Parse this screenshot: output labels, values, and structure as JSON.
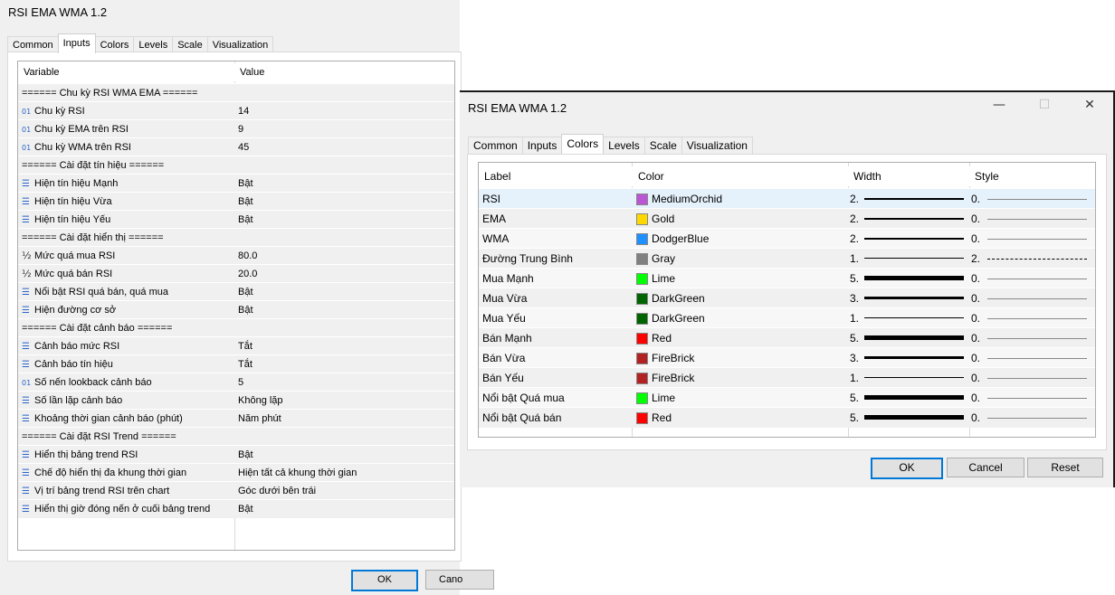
{
  "inputs_dialog": {
    "title": "RSI EMA WMA 1.2",
    "tabs": [
      "Common",
      "Inputs",
      "Colors",
      "Levels",
      "Scale",
      "Visualization"
    ],
    "active_tab": "Inputs",
    "columns": [
      "Variable",
      "Value"
    ],
    "rows": [
      {
        "icon": "",
        "variable": "====== Chu kỳ RSI WMA EMA ======",
        "value": ""
      },
      {
        "icon": "01",
        "variable": "Chu kỳ RSI",
        "value": "14"
      },
      {
        "icon": "01",
        "variable": "Chu kỳ EMA trên RSI",
        "value": "9"
      },
      {
        "icon": "01",
        "variable": "Chu kỳ WMA trên RSI",
        "value": "45"
      },
      {
        "icon": "",
        "variable": "====== Cài đặt tín hiệu ======",
        "value": ""
      },
      {
        "icon": "list",
        "variable": "Hiện tín hiệu Mạnh",
        "value": "Bật"
      },
      {
        "icon": "list",
        "variable": "Hiện tín hiệu Vừa",
        "value": "Bật"
      },
      {
        "icon": "list",
        "variable": "Hiện tín hiệu Yếu",
        "value": "Bật"
      },
      {
        "icon": "",
        "variable": "====== Cài đặt hiển thị ======",
        "value": ""
      },
      {
        "icon": "half",
        "variable": "Mức quá mua RSI",
        "value": "80.0"
      },
      {
        "icon": "half",
        "variable": "Mức quá bán RSI",
        "value": "20.0"
      },
      {
        "icon": "list",
        "variable": "Nổi bật RSI quá bán, quá mua",
        "value": "Bật"
      },
      {
        "icon": "list",
        "variable": "Hiện đường cơ sở",
        "value": "Bật"
      },
      {
        "icon": "",
        "variable": "====== Cài đặt cảnh báo ======",
        "value": ""
      },
      {
        "icon": "list",
        "variable": "Cảnh báo mức RSI",
        "value": "Tắt"
      },
      {
        "icon": "list",
        "variable": "Cảnh báo tín hiệu",
        "value": "Tắt"
      },
      {
        "icon": "01",
        "variable": "Số nến lookback cảnh báo",
        "value": "5"
      },
      {
        "icon": "list",
        "variable": "Số lần lặp cảnh báo",
        "value": "Không lặp"
      },
      {
        "icon": "list",
        "variable": "Khoảng thời gian cảnh báo (phút)",
        "value": "Năm phút"
      },
      {
        "icon": "",
        "variable": "====== Cài đặt RSI Trend ======",
        "value": ""
      },
      {
        "icon": "list",
        "variable": "Hiển thị bảng trend RSI",
        "value": "Bật"
      },
      {
        "icon": "list",
        "variable": "Chế độ hiển thị đa khung thời gian",
        "value": "Hiện tất cả khung thời gian"
      },
      {
        "icon": "list",
        "variable": "Vị trí bảng trend RSI trên chart",
        "value": "Góc dưới bên trái"
      },
      {
        "icon": "list",
        "variable": "Hiển thị giờ đóng nến ở cuối bảng trend",
        "value": "Bật"
      }
    ],
    "ok_label": "OK",
    "cancel_label": "Cano"
  },
  "colors_dialog": {
    "title": "RSI EMA WMA 1.2",
    "minimize_glyph": "—",
    "maximize_glyph": "☐",
    "close_glyph": "✕",
    "tabs": [
      "Common",
      "Inputs",
      "Colors",
      "Levels",
      "Scale",
      "Visualization"
    ],
    "active_tab": "Colors",
    "columns": [
      "Label",
      "Color",
      "Width",
      "Style"
    ],
    "rows": [
      {
        "label": "RSI",
        "color_name": "MediumOrchid",
        "color": "#BA55D3",
        "width": "2.",
        "width_val": 2,
        "style": "0.",
        "dashed": false
      },
      {
        "label": "EMA",
        "color_name": "Gold",
        "color": "#FFD700",
        "width": "2.",
        "width_val": 2,
        "style": "0.",
        "dashed": false
      },
      {
        "label": "WMA",
        "color_name": "DodgerBlue",
        "color": "#1E90FF",
        "width": "2.",
        "width_val": 2,
        "style": "0.",
        "dashed": false
      },
      {
        "label": "Đường Trung Bình",
        "color_name": "Gray",
        "color": "#808080",
        "width": "1.",
        "width_val": 1,
        "style": "2.",
        "dashed": true
      },
      {
        "label": "Mua Mạnh",
        "color_name": "Lime",
        "color": "#00FF00",
        "width": "5.",
        "width_val": 5,
        "style": "0.",
        "dashed": false
      },
      {
        "label": "Mua Vừa",
        "color_name": "DarkGreen",
        "color": "#006400",
        "width": "3.",
        "width_val": 3,
        "style": "0.",
        "dashed": false
      },
      {
        "label": "Mua Yếu",
        "color_name": "DarkGreen",
        "color": "#006400",
        "width": "1.",
        "width_val": 1,
        "style": "0.",
        "dashed": false
      },
      {
        "label": "Bán Mạnh",
        "color_name": "Red",
        "color": "#FF0000",
        "width": "5.",
        "width_val": 5,
        "style": "0.",
        "dashed": false
      },
      {
        "label": "Bán Vừa",
        "color_name": "FireBrick",
        "color": "#B22222",
        "width": "3.",
        "width_val": 3,
        "style": "0.",
        "dashed": false
      },
      {
        "label": "Bán Yếu",
        "color_name": "FireBrick",
        "color": "#B22222",
        "width": "1.",
        "width_val": 1,
        "style": "0.",
        "dashed": false
      },
      {
        "label": "Nổi bật Quá mua",
        "color_name": "Lime",
        "color": "#00FF00",
        "width": "5.",
        "width_val": 5,
        "style": "0.",
        "dashed": false
      },
      {
        "label": "Nổi bật Quá bán",
        "color_name": "Red",
        "color": "#FF0000",
        "width": "5.",
        "width_val": 5,
        "style": "0.",
        "dashed": false
      }
    ],
    "selected_row_color": "#e5f1fb",
    "ok_label": "OK",
    "cancel_label": "Cancel",
    "reset_label": "Reset"
  }
}
